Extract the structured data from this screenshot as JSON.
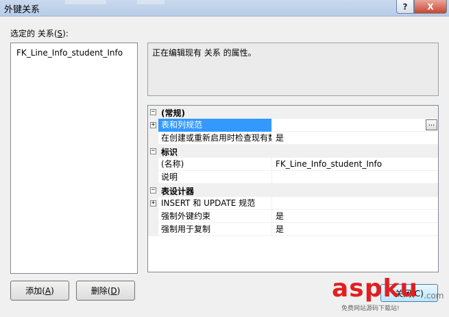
{
  "window": {
    "title": "外键关系"
  },
  "left": {
    "label_text": "选定的 关系(",
    "label_key": "S",
    "label_end": "):",
    "relationships": [
      "FK_Line_Info_student_Info"
    ]
  },
  "description": "正在编辑现有 关系 的属性。",
  "grid": {
    "rows": [
      {
        "type": "category",
        "expanded": true,
        "name": "(常规)"
      },
      {
        "type": "prop",
        "expander": "plus",
        "name": "表和列规范",
        "value": "",
        "selected": true,
        "has_ellipsis": true
      },
      {
        "type": "prop",
        "name": "在创建或重新启用时检查现有数据",
        "value": "是"
      },
      {
        "type": "category",
        "expanded": true,
        "name": "标识"
      },
      {
        "type": "prop",
        "name": "(名称)",
        "value": "FK_Line_Info_student_Info"
      },
      {
        "type": "prop",
        "name": "说明",
        "value": ""
      },
      {
        "type": "category",
        "expanded": true,
        "name": "表设计器"
      },
      {
        "type": "prop",
        "expander": "plus",
        "name": "INSERT 和 UPDATE 规范",
        "value": ""
      },
      {
        "type": "prop",
        "name": "强制外键约束",
        "value": "是"
      },
      {
        "type": "prop",
        "name": "强制用于复制",
        "value": "是"
      }
    ],
    "ellipsis_label": "..."
  },
  "buttons": {
    "add": {
      "text": "添加(",
      "key": "A",
      "end": ")"
    },
    "delete": {
      "text": "删除(",
      "key": "D",
      "end": ")"
    },
    "close": {
      "text": "关闭(C)"
    }
  },
  "title_buttons": {
    "help": "?",
    "close": "X"
  },
  "watermark": {
    "brand": "aspku",
    "tld": ".com",
    "tagline": "免费网站源码下载站!"
  }
}
